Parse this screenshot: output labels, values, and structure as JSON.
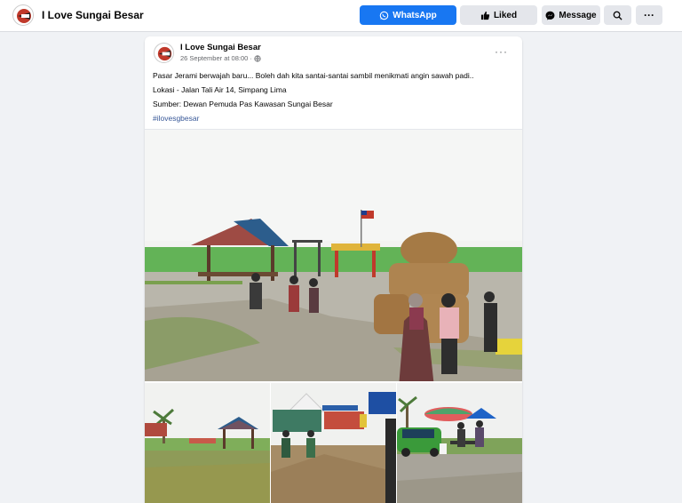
{
  "header": {
    "page_name": "I Love Sungai Besar",
    "whatsapp_label": "WhatsApp",
    "liked_label": "Liked",
    "message_label": "Message",
    "more_label": "···"
  },
  "post": {
    "author": "I Love Sungai Besar",
    "timestamp": "26 September at 08:00 ·",
    "lines": [
      "Pasar Jerami berwajah baru... Boleh dah kita santai-santai sambil menikmati angin sawah padi..",
      "Lokasi - Jalan Tali Air 14, Simpang Lima",
      "Sumber: Dewan Pemuda Pas Kawasan Sungai Besar"
    ],
    "hashtag": "#ilovesgbesar",
    "options_label": "···"
  },
  "colors": {
    "accent": "#1877f2",
    "button_grey": "#e4e6eb",
    "link": "#385898"
  }
}
